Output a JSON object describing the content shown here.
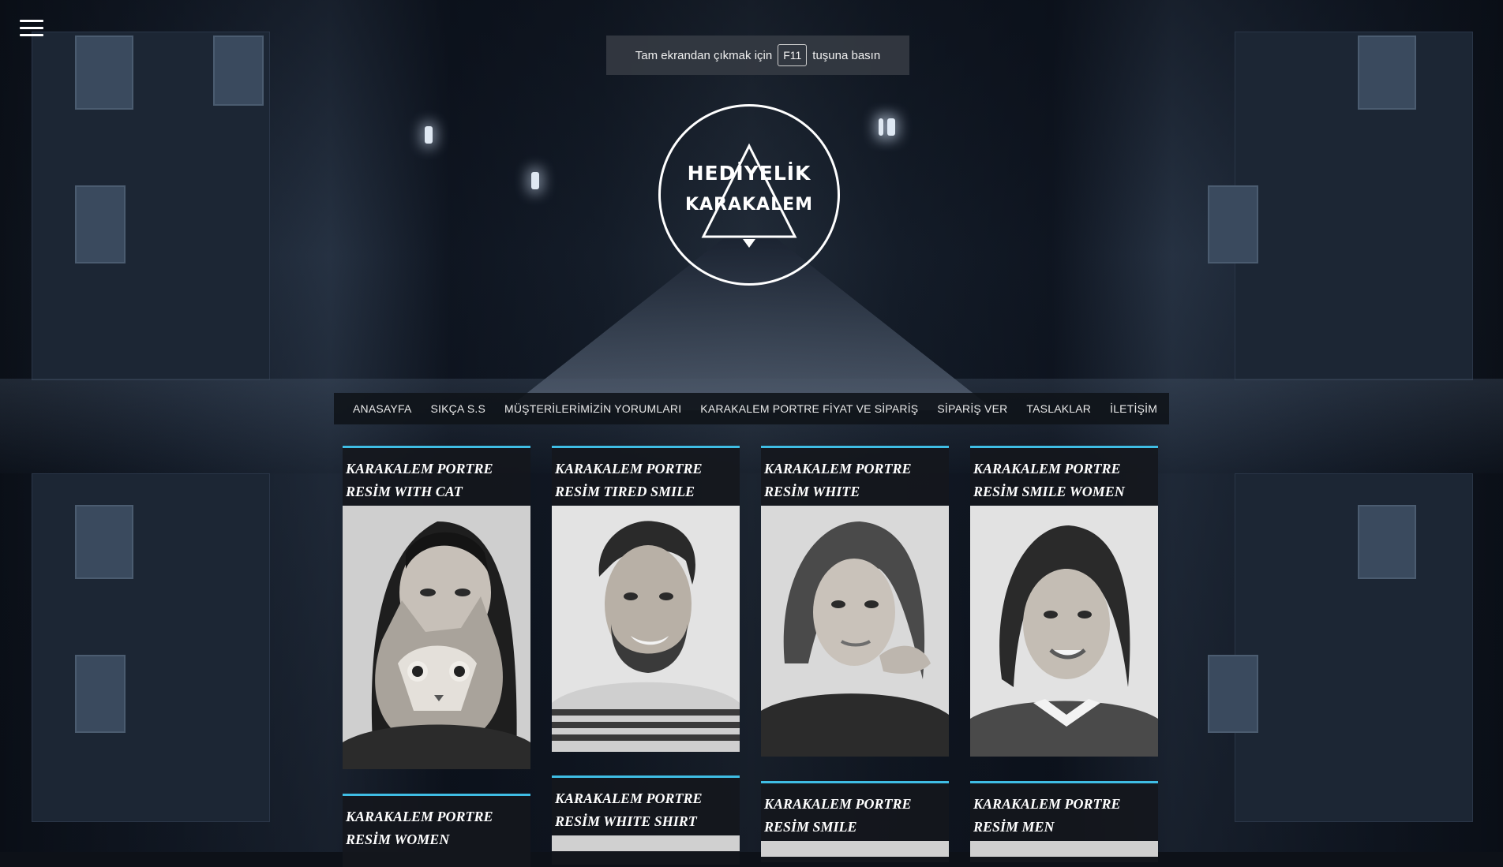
{
  "menu": {
    "icon": "hamburger-menu-icon"
  },
  "fullscreen_notice": {
    "before": "Tam ekrandan çıkmak için",
    "key": "F11",
    "after": "tuşuna basın"
  },
  "logo": {
    "line1": "HEDİYELİK",
    "line2": "KARAKALEM"
  },
  "nav": [
    "ANASAYFA",
    "SIKÇA S.S",
    "MÜŞTERİLERİMİZİN YORUMLARI",
    "KARAKALEM PORTRE FİYAT VE SİPARİŞ",
    "SİPARİŞ VER",
    "TASLAKLAR",
    "İLETİŞİM"
  ],
  "posts": [
    {
      "title": "KARAKALEM PORTRE RESİM WITH CAT",
      "image": "portrait-woman-with-cat"
    },
    {
      "title": "KARAKALEM PORTRE RESİM TIRED SMILE",
      "image": "portrait-smiling-man"
    },
    {
      "title": "KARAKALEM PORTRE RESİM WHITE",
      "image": "portrait-woman-hand-on-chin"
    },
    {
      "title": "KARAKALEM PORTRE RESİM SMILE WOMEN",
      "image": "portrait-smiling-woman"
    },
    {
      "title": "KARAKALEM PORTRE RESİM WOMEN",
      "image": ""
    },
    {
      "title": "KARAKALEM PORTRE RESİM WHITE SHIRT",
      "image": ""
    },
    {
      "title": "KARAKALEM PORTRE RESİM SMILE",
      "image": ""
    },
    {
      "title": "KARAKALEM PORTRE RESİM MEN",
      "image": ""
    }
  ],
  "colors": {
    "accent": "#3fbde4",
    "nav_bg": "#10141a",
    "card_bg": "#14171c"
  }
}
